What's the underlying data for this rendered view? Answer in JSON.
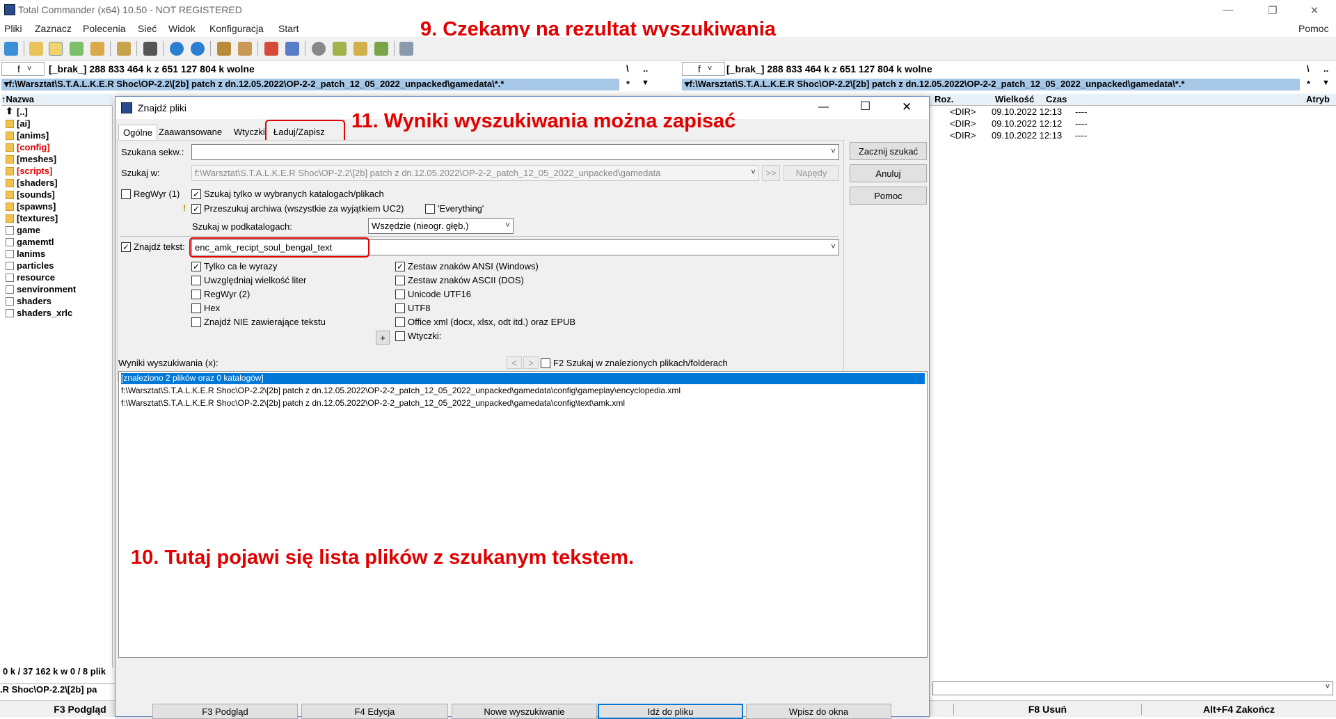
{
  "window": {
    "title": "Total Commander (x64) 10.50 - NOT REGISTERED",
    "minimize": "—",
    "maximize": "❐",
    "close": "✕"
  },
  "menu": [
    "Pliki",
    "Zaznacz",
    "Polecenia",
    "Sieć",
    "Widok",
    "Konfiguracja",
    "Start"
  ],
  "menu_right": "Pomoc",
  "annotations": {
    "a9": "9. Czekamy na rezultat wyszukiwania",
    "a10": "10. Tutaj pojawi się lista plików z szukanym tekstem.",
    "a11": "11.  Wyniki wyszukiwania można zapisać"
  },
  "left_panel": {
    "drive": "f",
    "free": "[_brak_]  288 833 464 k z 651 127 804 k wolne",
    "path": "f:\\Warsztat\\S.T.A.L.K.E.R Shoc\\OP-2.2\\[2b] patch z dn.12.05.2022\\OP-2-2_patch_12_05_2022_unpacked\\gamedata\\*.*",
    "root": "\\",
    "updir": "..",
    "star": "*",
    "col_name": "Nazwa",
    "files": [
      {
        "name": "[..]",
        "type": "up",
        "red": false
      },
      {
        "name": "[ai]",
        "type": "fold",
        "red": false
      },
      {
        "name": "[anims]",
        "type": "fold",
        "red": false
      },
      {
        "name": "[config]",
        "type": "fold",
        "red": true
      },
      {
        "name": "[meshes]",
        "type": "fold",
        "red": false
      },
      {
        "name": "[scripts]",
        "type": "fold",
        "red": true
      },
      {
        "name": "[shaders]",
        "type": "fold",
        "red": false
      },
      {
        "name": "[sounds]",
        "type": "fold",
        "red": false
      },
      {
        "name": "[spawns]",
        "type": "fold",
        "red": false
      },
      {
        "name": "[textures]",
        "type": "fold",
        "red": false
      },
      {
        "name": "game",
        "type": "doc",
        "red": false
      },
      {
        "name": "gamemtl",
        "type": "doc",
        "red": false
      },
      {
        "name": "lanims",
        "type": "doc",
        "red": false
      },
      {
        "name": "particles",
        "type": "doc",
        "red": false
      },
      {
        "name": "resource",
        "type": "doc",
        "red": false
      },
      {
        "name": "senvironment",
        "type": "doc",
        "red": false
      },
      {
        "name": "shaders",
        "type": "doc",
        "red": false
      },
      {
        "name": "shaders_xrlc",
        "type": "doc",
        "red": false
      }
    ],
    "status": "0 k / 37 162 k w 0 / 8 plik",
    "cmdpath": ".R Shoc\\OP-2.2\\[2b] pa"
  },
  "right_panel": {
    "drive": "f",
    "free": "[_brak_]  288 833 464 k z 651 127 804 k wolne",
    "path": "f:\\Warsztat\\S.T.A.L.K.E.R Shoc\\OP-2.2\\[2b] patch z dn.12.05.2022\\OP-2-2_patch_12_05_2022_unpacked\\gamedata\\*.*",
    "root": "\\",
    "updir": "..",
    "star": "*",
    "cols": {
      "ext": "Roz.",
      "size": "Wielkość",
      "time": "Czas",
      "attr": "Atryb"
    },
    "rows": [
      {
        "size": "<DIR>",
        "time": "09.10.2022 12:13",
        "attr": "----"
      },
      {
        "size": "<DIR>",
        "time": "09.10.2022 12:12",
        "attr": "----"
      },
      {
        "size": "<DIR>",
        "time": "09.10.2022 12:13",
        "attr": "----"
      }
    ]
  },
  "fkeys": {
    "f3": "F3 Podgląd",
    "f8": "F8 Usuń",
    "altf4": "Alt+F4 Zakończ"
  },
  "dialog": {
    "title": "Znajdź pliki",
    "tabs": [
      "Ogólne",
      "Zaawansowane",
      "Wtyczki",
      "Ładuj/Zapisz"
    ],
    "search_for_label": "Szukana sekw.:",
    "search_for_value": "",
    "search_in_label": "Szukaj w:",
    "search_in_value": "f:\\Warsztat\\S.T.A.L.K.E.R Shoc\\OP-2.2\\[2b] patch z dn.12.05.2022\\OP-2-2_patch_12_05_2022_unpacked\\gamedata",
    "more_btn": ">>",
    "drives_btn": "Napędy",
    "regex1": "RegWyr (1)",
    "only_selected": "Szukaj tylko w wybranych katalogach/plikach",
    "archives": "Przeszukuj archiwa (wszystkie za wyjątkiem UC2)",
    "everything": "'Everything'",
    "subdirs_label": "Szukaj w podkatalogach:",
    "subdirs_value": "Wszędzie (nieogr. głęb.)",
    "find_text_label": "Znajdź tekst:",
    "find_text_value": "enc_amk_recipt_soul_bengal_text",
    "opts_left": [
      {
        "label": "Tylko ca łe wyrazy",
        "checked": true
      },
      {
        "label": "Uwzględniaj wielkość liter",
        "checked": false
      },
      {
        "label": "RegWyr (2)",
        "checked": false
      },
      {
        "label": "Hex",
        "checked": false
      },
      {
        "label": "Znajdź NIE zawierające tekstu",
        "checked": false
      }
    ],
    "opts_right": [
      {
        "label": "Zestaw znaków ANSI (Windows)",
        "checked": true
      },
      {
        "label": "Zestaw znaków ASCII (DOS)",
        "checked": false
      },
      {
        "label": "Unicode UTF16",
        "checked": false
      },
      {
        "label": "UTF8",
        "checked": false
      },
      {
        "label": "Office xml (docx, xlsx, odt itd.) oraz EPUB",
        "checked": false
      },
      {
        "label": "Wtyczki:",
        "checked": false
      }
    ],
    "plus_btn": "+",
    "btn_start": "Zacznij szukać",
    "btn_cancel": "Anuluj",
    "btn_help": "Pomoc",
    "results_label": "Wyniki wyszukiwania (x):",
    "nav_prev": "<",
    "nav_next": ">",
    "f2_search": "F2 Szukaj w znalezionych plikach/folderach",
    "results": [
      "[znaleziono 2 plików oraz 0 katalogów]",
      "f:\\Warsztat\\S.T.A.L.K.E.R Shoc\\OP-2.2\\[2b] patch z dn.12.05.2022\\OP-2-2_patch_12_05_2022_unpacked\\gamedata\\config\\gameplay\\encyclopedia.xml",
      "f:\\Warsztat\\S.T.A.L.K.E.R Shoc\\OP-2.2\\[2b] patch z dn.12.05.2022\\OP-2-2_patch_12_05_2022_unpacked\\gamedata\\config\\text\\amk.xml"
    ],
    "bottom_btns": [
      "F3 Podgląd",
      "F4 Edycja",
      "Nowe wyszukiwanie",
      "Idź do pliku",
      "Wpisz do okna"
    ],
    "win_minimize": "—",
    "win_maximize": "☐",
    "win_close": "✕"
  }
}
